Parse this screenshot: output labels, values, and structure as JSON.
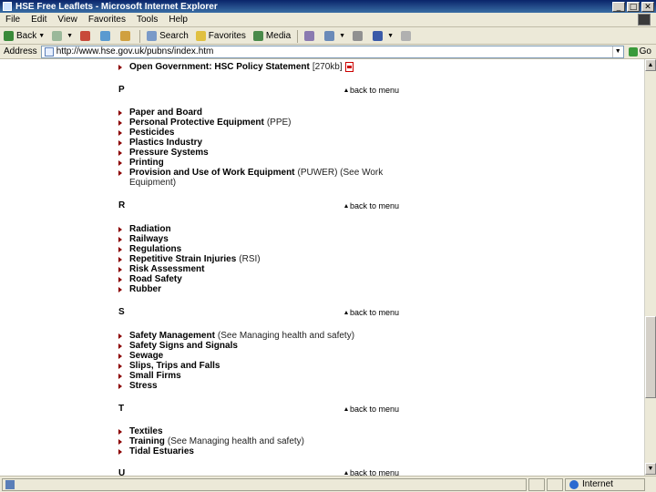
{
  "window": {
    "title": "HSE Free Leaflets - Microsoft Internet Explorer",
    "minimize": "_",
    "maximize": "□",
    "close": "✕"
  },
  "menu": [
    "File",
    "Edit",
    "View",
    "Favorites",
    "Tools",
    "Help"
  ],
  "toolbar": {
    "back": "Back",
    "search": "Search",
    "favorites": "Favorites",
    "media": "Media"
  },
  "address": {
    "label": "Address",
    "url": "http://www.hse.gov.uk/pubns/index.htm",
    "go": "Go"
  },
  "content": {
    "back_to_menu": "back to menu",
    "top_item": {
      "label": "Open Government: HSC Policy Statement",
      "note": "[270kb]"
    },
    "sections": [
      {
        "letter": "P",
        "items": [
          {
            "label": "Paper and Board",
            "note": ""
          },
          {
            "label": "Personal Protective Equipment",
            "note": "(PPE)"
          },
          {
            "label": "Pesticides",
            "note": ""
          },
          {
            "label": "Plastics Industry",
            "note": ""
          },
          {
            "label": "Pressure Systems",
            "note": ""
          },
          {
            "label": "Printing",
            "note": ""
          },
          {
            "label": "Provision and Use of Work Equipment",
            "note": "(PUWER) (See Work"
          }
        ],
        "wrap": "Equipment)"
      },
      {
        "letter": "R",
        "items": [
          {
            "label": "Radiation",
            "note": ""
          },
          {
            "label": "Railways",
            "note": ""
          },
          {
            "label": "Regulations",
            "note": ""
          },
          {
            "label": "Repetitive Strain Injuries",
            "note": "(RSI)"
          },
          {
            "label": "Risk Assessment",
            "note": ""
          },
          {
            "label": "Road Safety",
            "note": ""
          },
          {
            "label": "Rubber",
            "note": ""
          }
        ]
      },
      {
        "letter": "S",
        "items": [
          {
            "label": "Safety Management",
            "note": "(See Managing health and safety)"
          },
          {
            "label": "Safety Signs and Signals",
            "note": ""
          },
          {
            "label": "Sewage",
            "note": ""
          },
          {
            "label": "Slips, Trips and Falls",
            "note": ""
          },
          {
            "label": "Small Firms",
            "note": ""
          },
          {
            "label": "Stress",
            "note": ""
          }
        ]
      },
      {
        "letter": "T",
        "items": [
          {
            "label": "Textiles",
            "note": ""
          },
          {
            "label": "Training",
            "note": "(See Managing health and safety)"
          },
          {
            "label": "Tidal Estuaries",
            "note": ""
          }
        ]
      },
      {
        "letter": "U",
        "items": []
      }
    ]
  },
  "status": {
    "zone": "Internet"
  },
  "colors": {
    "titlebar": "#0a246a",
    "bullet": "#8b0000",
    "chrome": "#ece9d8"
  }
}
